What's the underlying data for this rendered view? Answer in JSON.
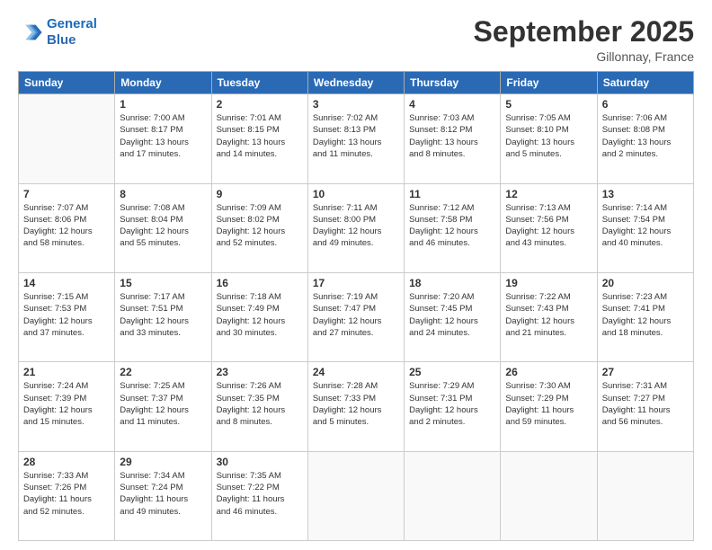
{
  "header": {
    "logo_line1": "General",
    "logo_line2": "Blue",
    "month": "September 2025",
    "location": "Gillonnay, France"
  },
  "days_of_week": [
    "Sunday",
    "Monday",
    "Tuesday",
    "Wednesday",
    "Thursday",
    "Friday",
    "Saturday"
  ],
  "weeks": [
    [
      {
        "day": "",
        "info": ""
      },
      {
        "day": "1",
        "info": "Sunrise: 7:00 AM\nSunset: 8:17 PM\nDaylight: 13 hours\nand 17 minutes."
      },
      {
        "day": "2",
        "info": "Sunrise: 7:01 AM\nSunset: 8:15 PM\nDaylight: 13 hours\nand 14 minutes."
      },
      {
        "day": "3",
        "info": "Sunrise: 7:02 AM\nSunset: 8:13 PM\nDaylight: 13 hours\nand 11 minutes."
      },
      {
        "day": "4",
        "info": "Sunrise: 7:03 AM\nSunset: 8:12 PM\nDaylight: 13 hours\nand 8 minutes."
      },
      {
        "day": "5",
        "info": "Sunrise: 7:05 AM\nSunset: 8:10 PM\nDaylight: 13 hours\nand 5 minutes."
      },
      {
        "day": "6",
        "info": "Sunrise: 7:06 AM\nSunset: 8:08 PM\nDaylight: 13 hours\nand 2 minutes."
      }
    ],
    [
      {
        "day": "7",
        "info": "Sunrise: 7:07 AM\nSunset: 8:06 PM\nDaylight: 12 hours\nand 58 minutes."
      },
      {
        "day": "8",
        "info": "Sunrise: 7:08 AM\nSunset: 8:04 PM\nDaylight: 12 hours\nand 55 minutes."
      },
      {
        "day": "9",
        "info": "Sunrise: 7:09 AM\nSunset: 8:02 PM\nDaylight: 12 hours\nand 52 minutes."
      },
      {
        "day": "10",
        "info": "Sunrise: 7:11 AM\nSunset: 8:00 PM\nDaylight: 12 hours\nand 49 minutes."
      },
      {
        "day": "11",
        "info": "Sunrise: 7:12 AM\nSunset: 7:58 PM\nDaylight: 12 hours\nand 46 minutes."
      },
      {
        "day": "12",
        "info": "Sunrise: 7:13 AM\nSunset: 7:56 PM\nDaylight: 12 hours\nand 43 minutes."
      },
      {
        "day": "13",
        "info": "Sunrise: 7:14 AM\nSunset: 7:54 PM\nDaylight: 12 hours\nand 40 minutes."
      }
    ],
    [
      {
        "day": "14",
        "info": "Sunrise: 7:15 AM\nSunset: 7:53 PM\nDaylight: 12 hours\nand 37 minutes."
      },
      {
        "day": "15",
        "info": "Sunrise: 7:17 AM\nSunset: 7:51 PM\nDaylight: 12 hours\nand 33 minutes."
      },
      {
        "day": "16",
        "info": "Sunrise: 7:18 AM\nSunset: 7:49 PM\nDaylight: 12 hours\nand 30 minutes."
      },
      {
        "day": "17",
        "info": "Sunrise: 7:19 AM\nSunset: 7:47 PM\nDaylight: 12 hours\nand 27 minutes."
      },
      {
        "day": "18",
        "info": "Sunrise: 7:20 AM\nSunset: 7:45 PM\nDaylight: 12 hours\nand 24 minutes."
      },
      {
        "day": "19",
        "info": "Sunrise: 7:22 AM\nSunset: 7:43 PM\nDaylight: 12 hours\nand 21 minutes."
      },
      {
        "day": "20",
        "info": "Sunrise: 7:23 AM\nSunset: 7:41 PM\nDaylight: 12 hours\nand 18 minutes."
      }
    ],
    [
      {
        "day": "21",
        "info": "Sunrise: 7:24 AM\nSunset: 7:39 PM\nDaylight: 12 hours\nand 15 minutes."
      },
      {
        "day": "22",
        "info": "Sunrise: 7:25 AM\nSunset: 7:37 PM\nDaylight: 12 hours\nand 11 minutes."
      },
      {
        "day": "23",
        "info": "Sunrise: 7:26 AM\nSunset: 7:35 PM\nDaylight: 12 hours\nand 8 minutes."
      },
      {
        "day": "24",
        "info": "Sunrise: 7:28 AM\nSunset: 7:33 PM\nDaylight: 12 hours\nand 5 minutes."
      },
      {
        "day": "25",
        "info": "Sunrise: 7:29 AM\nSunset: 7:31 PM\nDaylight: 12 hours\nand 2 minutes."
      },
      {
        "day": "26",
        "info": "Sunrise: 7:30 AM\nSunset: 7:29 PM\nDaylight: 11 hours\nand 59 minutes."
      },
      {
        "day": "27",
        "info": "Sunrise: 7:31 AM\nSunset: 7:27 PM\nDaylight: 11 hours\nand 56 minutes."
      }
    ],
    [
      {
        "day": "28",
        "info": "Sunrise: 7:33 AM\nSunset: 7:26 PM\nDaylight: 11 hours\nand 52 minutes."
      },
      {
        "day": "29",
        "info": "Sunrise: 7:34 AM\nSunset: 7:24 PM\nDaylight: 11 hours\nand 49 minutes."
      },
      {
        "day": "30",
        "info": "Sunrise: 7:35 AM\nSunset: 7:22 PM\nDaylight: 11 hours\nand 46 minutes."
      },
      {
        "day": "",
        "info": ""
      },
      {
        "day": "",
        "info": ""
      },
      {
        "day": "",
        "info": ""
      },
      {
        "day": "",
        "info": ""
      }
    ]
  ]
}
